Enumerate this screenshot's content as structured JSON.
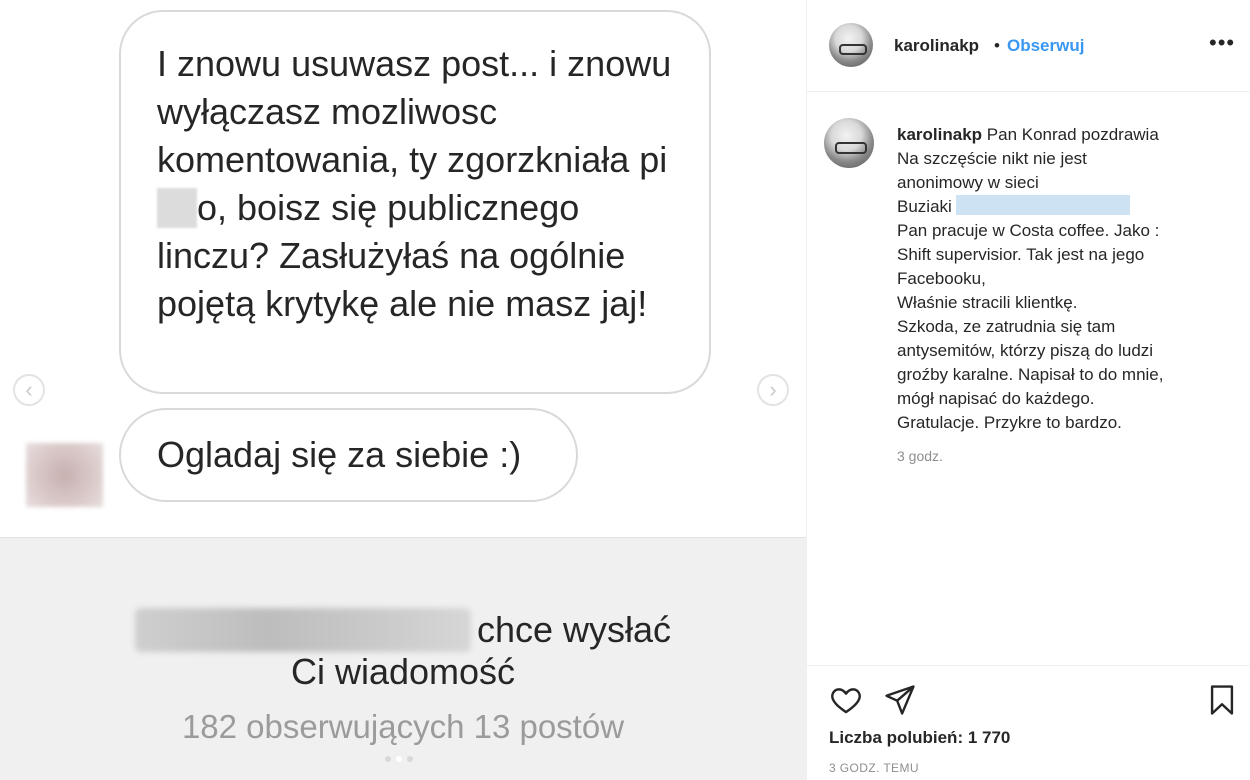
{
  "post": {
    "message_1": "I znowu usuwasz post... i znowu wyłączasz mozliwosc komentowania, ty zgorzkniała pi",
    "message_1_end": "o, boisz się publicznego linczu? Zasłużyłaś na ogólnie pojętą krytykę ale nie masz jaj!",
    "message_2": "Ogladaj się za siebie :)",
    "request_text_1": "chce wysłać",
    "request_text_2": "Ci wiadomość",
    "request_stats": "182 obserwujących 13 postów",
    "prev_arrow": "‹",
    "next_arrow": "›",
    "carousel_pages": 3,
    "carousel_active": 1
  },
  "header": {
    "username": "karolinakp",
    "separator": "•",
    "follow_label": "Obserwuj",
    "more_icon": "•••"
  },
  "caption": {
    "username": "karolinakp",
    "lines": [
      "Pan Konrad pozdrawia",
      "Na szczęście nikt nie jest",
      "anonimowy w sieci",
      "Buziaki",
      "Pan pracuje w Costa coffee. Jako :",
      "Shift supervisior. Tak jest na jego",
      "Facebooku,",
      "Właśnie stracili klientkę.",
      "Szkoda, ze zatrudnia się tam",
      "antysemitów, którzy piszą do ludzi",
      "groźby karalne. Napisał to do mnie,",
      "mógł napisać do każdego.",
      "Gratulacje. Przykre to bardzo."
    ],
    "time": "3 godz."
  },
  "actions": {
    "likes": "Liczba polubień: 1 770",
    "post_age": "3 GODZ. TEMU",
    "icons": [
      "heart-icon",
      "share-icon",
      "bookmark-icon"
    ]
  },
  "colors": {
    "accent": "#3897f0",
    "muted": "#8e8e8e",
    "border": "#efefef"
  }
}
